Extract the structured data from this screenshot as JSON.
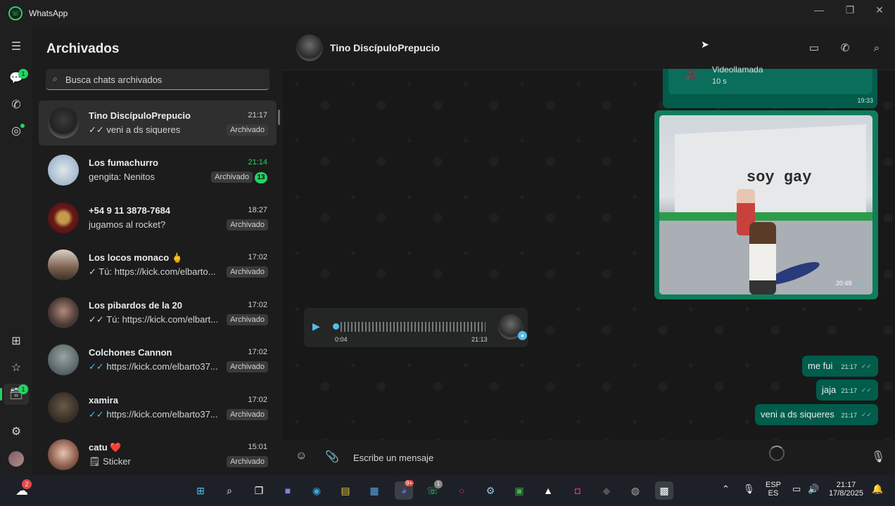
{
  "window": {
    "title": "WhatsApp",
    "minimize": "—",
    "maximize": "❐",
    "close": "✕"
  },
  "rail": {
    "chat_badge": "1",
    "archived_badge": "1"
  },
  "panel": {
    "title": "Archivados",
    "search_placeholder": "Busca chats archivados",
    "chats": [
      {
        "name": "Tino DiscípuloPrepucio",
        "time": "21:17",
        "tick": "✓✓",
        "preview": "veni a ds siqueres",
        "tag": "Archivado"
      },
      {
        "name": "Los fumachurro",
        "time": "21:14",
        "tick": "",
        "preview": "gengita: Nenitos",
        "tag": "Archivado",
        "unread": "13"
      },
      {
        "name": "+54 9 11 3878-7684",
        "time": "18:27",
        "tick": "",
        "preview": "jugamos al rocket?",
        "tag": "Archivado"
      },
      {
        "name": "Los locos monaco 🖕",
        "time": "17:02",
        "tick": "✓",
        "preview": "Tú: https://kick.com/elbarto...",
        "tag": "Archivado"
      },
      {
        "name": "Los pibardos de la 20",
        "time": "17:02",
        "tick": "✓✓",
        "preview": "Tú: https://kick.com/elbart...",
        "tag": "Archivado"
      },
      {
        "name": "Colchones Cannon",
        "time": "17:02",
        "tick": "✓✓",
        "preview": "https://kick.com/elbarto37...",
        "tag": "Archivado"
      },
      {
        "name": "xamira",
        "time": "17:02",
        "tick": "✓✓",
        "preview": "https://kick.com/elbarto37...",
        "tag": "Archivado"
      },
      {
        "name": "catu ❤️",
        "time": "15:01",
        "tick": "🗒",
        "preview": "Sticker",
        "tag": "Archivado"
      }
    ]
  },
  "conversation": {
    "contact": "Tino DiscípuloPrepucio",
    "call_message": {
      "title": "Videollamada",
      "duration": "10 s",
      "time": "19:33"
    },
    "media": {
      "caption": "soy gay",
      "time": "20:49",
      "ticks": "✓✓"
    },
    "voice": {
      "elapsed": "0:04",
      "time": "21:13"
    },
    "messages": [
      {
        "text": "me fui",
        "time": "21:17",
        "ticks": "✓✓"
      },
      {
        "text": "jaja",
        "time": "21:17",
        "ticks": "✓✓"
      },
      {
        "text": "veni a ds siqueres",
        "time": "21:17",
        "ticks": "✓✓"
      }
    ],
    "composer_placeholder": "Escribe un mensaje"
  },
  "taskbar": {
    "weather_badge": "2",
    "discord_badge": "9+",
    "whatsapp_badge": "1",
    "lang": "ESP",
    "lang_sub": "ES",
    "clock_time": "21:17",
    "clock_date": "17/8/2025"
  },
  "colors": {
    "accent": "#25d366",
    "outgoing": "#005c4b",
    "incoming": "#242626",
    "tick_blue": "#53bdeb"
  }
}
